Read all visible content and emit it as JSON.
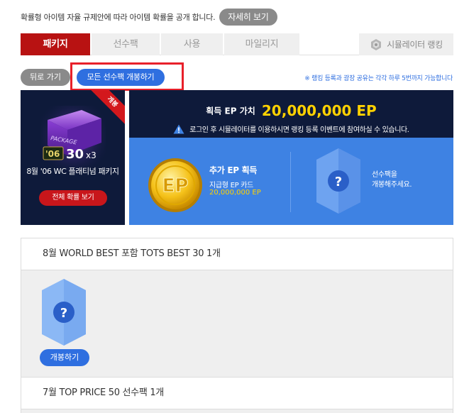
{
  "notice": {
    "text": "확률형 아이템 자율 규제안에 따라 아이템 확률을 공개 합니다.",
    "detail_label": "자세히 보기"
  },
  "tabs": {
    "items": [
      {
        "label": "패키지",
        "active": true
      },
      {
        "label": "선수팩",
        "active": false
      },
      {
        "label": "사용",
        "active": false
      },
      {
        "label": "마일리지",
        "active": false
      }
    ],
    "simulator_label": "시뮬레이터 랭킹"
  },
  "actions": {
    "back_label": "뒤로 가기",
    "open_all_label": "모든 선수팩 개봉하기",
    "rank_note": "※ 랭킹 등록과 광장 공유는 각각 하루 5번까지 가능합니다"
  },
  "package": {
    "ribbon": "개봉",
    "box_text": "PACKAGE",
    "season": "'06",
    "ovr": "30",
    "multiplier": "x3",
    "name": "8월 '06 WC 플래티넘 패키지",
    "prob_button": "전체 확률 보기"
  },
  "ep": {
    "value_label": "획득 EP 가치",
    "value": "20,000,000 EP",
    "warning": "로그인 후 시뮬레이터를 이용하시면 랭킹 등록 이벤트에 참여하실 수 있습니다.",
    "coin_text": "EP",
    "extra_title": "추가 EP 획득",
    "extra_sub": "지급형 EP 카드",
    "extra_amount": "20,000,000 EP",
    "pack_hint_line1": "선수팩을",
    "pack_hint_line2": "개봉해주세요."
  },
  "sections": [
    {
      "title": "8월 WORLD BEST 포함 TOTS BEST 30 1개",
      "open_label": "개봉하기"
    },
    {
      "title": "7월 TOP PRICE 50 선수팩 1개"
    }
  ],
  "colors": {
    "brand_red": "#b81212",
    "accent_blue": "#2f6fe0",
    "panel_navy": "#0e1a3a",
    "panel_blue": "#3e82e3",
    "ep_yellow": "#ffd200"
  }
}
